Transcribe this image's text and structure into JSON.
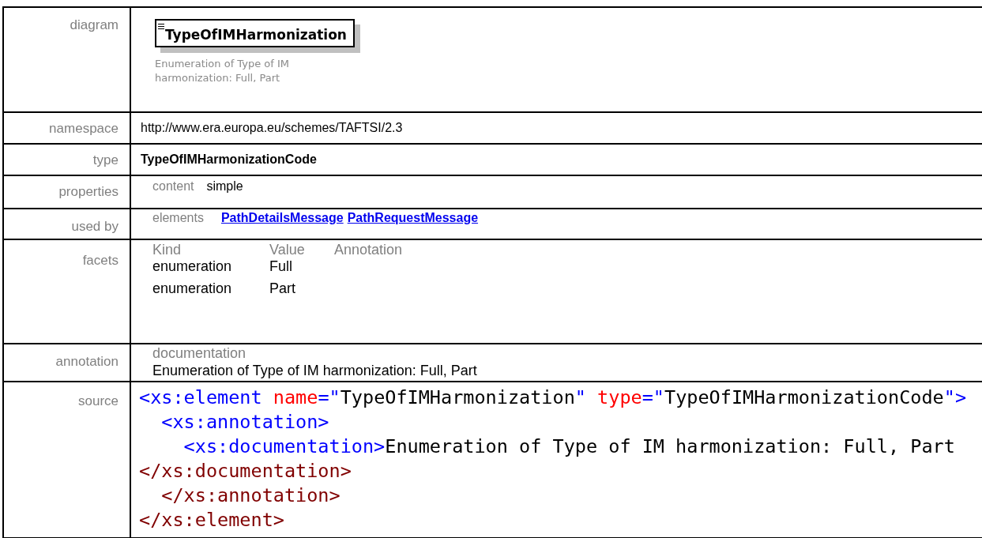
{
  "diagram": {
    "label": "diagram",
    "element_name": "TypeOfIMHarmonization",
    "annotation_lines": [
      "Enumeration of Type of IM",
      "harmonization: Full, Part"
    ]
  },
  "namespace": {
    "label": "namespace",
    "value": "http://www.era.europa.eu/schemes/TAFTSI/2.3"
  },
  "type": {
    "label": "type",
    "value": "TypeOfIMHarmonizationCode"
  },
  "properties": {
    "label": "properties",
    "key": "content",
    "value": "simple"
  },
  "used_by": {
    "label": "used by",
    "key": "elements",
    "links": [
      "PathDetailsMessage",
      "PathRequestMessage"
    ]
  },
  "facets": {
    "label": "facets",
    "columns": [
      "Kind",
      "Value",
      "Annotation"
    ],
    "rows": [
      {
        "kind": "enumeration",
        "value": "Full"
      },
      {
        "kind": "enumeration",
        "value": "Part"
      }
    ]
  },
  "annotation": {
    "label": "annotation",
    "key": "documentation",
    "text": "Enumeration of Type of IM harmonization: Full, Part"
  },
  "source": {
    "label": "source",
    "lines": [
      [
        {
          "kind": "tag",
          "text": "<xs:element"
        },
        {
          "kind": "attr",
          "text": " name"
        },
        {
          "kind": "punct",
          "text": "=\""
        },
        {
          "kind": "value",
          "text": "TypeOfIMHarmonization"
        },
        {
          "kind": "punct",
          "text": "\""
        },
        {
          "kind": "attr",
          "text": " type"
        },
        {
          "kind": "punct",
          "text": "=\""
        },
        {
          "kind": "value",
          "text": "TypeOfIMHarmonizationCode"
        },
        {
          "kind": "punct",
          "text": "\">"
        }
      ],
      [
        {
          "kind": "tag",
          "text": "  <xs:annotation>"
        }
      ],
      [
        {
          "kind": "tag",
          "text": "    <xs:documentation>"
        },
        {
          "kind": "text",
          "text": "Enumeration of Type of IM harmonization: Full, Part"
        }
      ],
      [
        {
          "kind": "endtag",
          "text": "</xs:documentation>"
        }
      ],
      [
        {
          "kind": "endtag",
          "text": "  </xs:annotation>"
        }
      ],
      [
        {
          "kind": "endtag",
          "text": "</xs:element>"
        }
      ]
    ]
  }
}
